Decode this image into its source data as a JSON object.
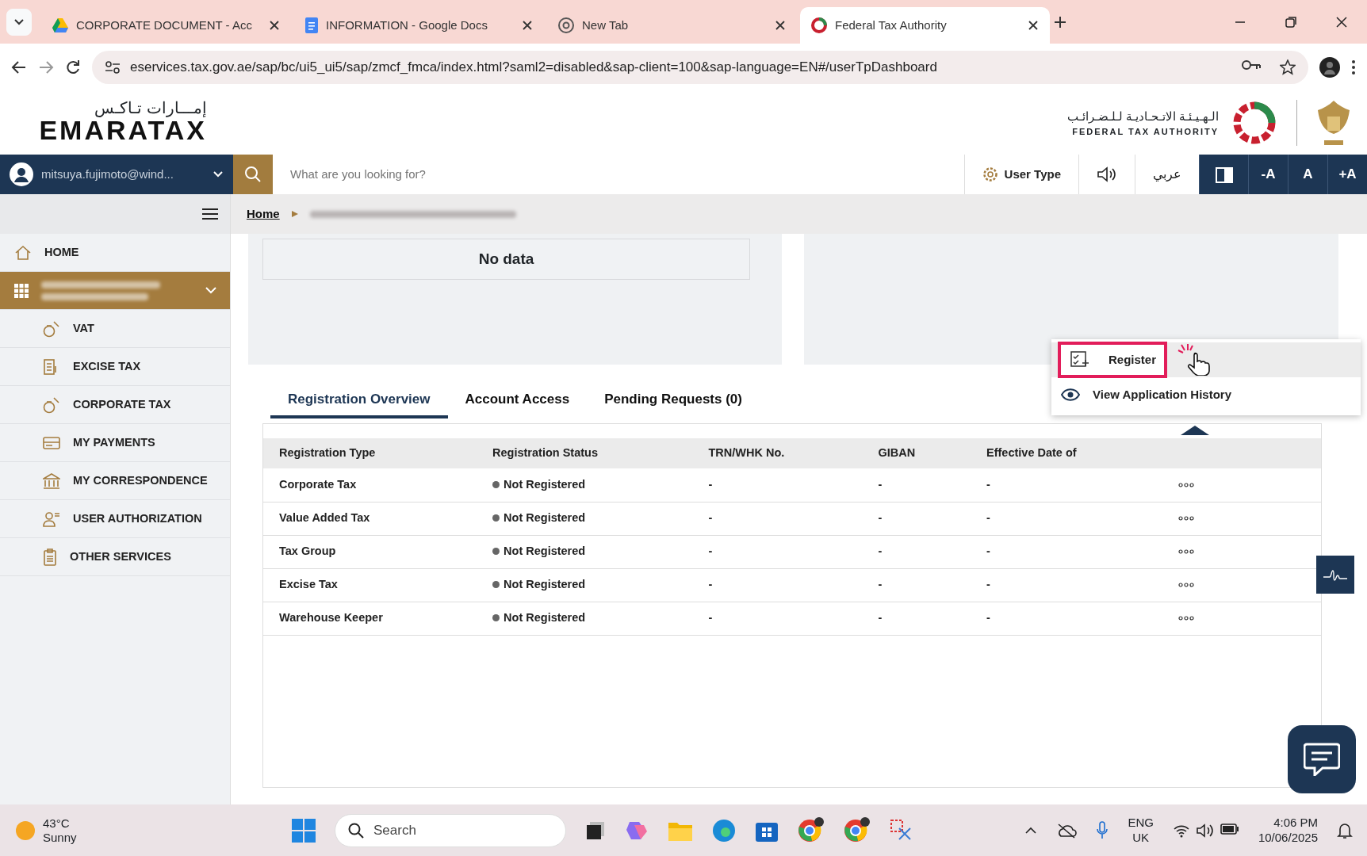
{
  "browser": {
    "tabs": [
      {
        "title": "CORPORATE DOCUMENT - Acc",
        "kind": "drive",
        "selected": false
      },
      {
        "title": "INFORMATION - Google Docs",
        "kind": "docs",
        "selected": false
      },
      {
        "title": "New Tab",
        "kind": "chrome",
        "selected": false
      },
      {
        "title": "Federal Tax Authority",
        "kind": "fta",
        "selected": true
      }
    ],
    "url": "eservices.tax.gov.ae/sap/bc/ui5_ui5/sap/zmcf_fmca/index.html?saml2=disabled&sap-client=100&sap-language=EN#/userTpDashboard"
  },
  "header": {
    "logo_arabic": "إمـــارات تـاكـس",
    "logo": "EMARATAX",
    "authority_arabic": "الـهـيـئـة الاتـحـاديـة لـلـضـرائـب",
    "authority": "FEDERAL TAX AUTHORITY"
  },
  "toolbar": {
    "user": "mitsuya.fujimoto@wind...",
    "search_placeholder": "What are you looking for?",
    "user_type": "User Type",
    "language": "عربي",
    "font_buttons": [
      "-A",
      "A",
      "+A"
    ]
  },
  "breadcrumb": {
    "home": "Home"
  },
  "sidebar": {
    "items": [
      {
        "label": "HOME",
        "kind": "home",
        "selected": false
      },
      {
        "kind": "grid",
        "selected": true,
        "expanded": true,
        "children": [
          {
            "label": "VAT",
            "kind": "moneybag"
          },
          {
            "label": "EXCISE TAX",
            "kind": "doc"
          },
          {
            "label": "CORPORATE TAX",
            "kind": "moneybag"
          },
          {
            "label": "MY PAYMENTS",
            "kind": "card"
          },
          {
            "label": "MY CORRESPONDENCE",
            "kind": "bank"
          },
          {
            "label": "USER AUTHORIZATION",
            "kind": "user"
          },
          {
            "label": "OTHER SERVICES",
            "kind": "clipboard"
          }
        ]
      }
    ]
  },
  "panel": {
    "message": "No data"
  },
  "tabs": [
    {
      "label": "Registration Overview",
      "selected": true
    },
    {
      "label": "Account Access",
      "selected": false
    },
    {
      "label": "Pending Requests (0)",
      "selected": false
    }
  ],
  "table": {
    "columns": [
      "Registration Type",
      "Registration Status",
      "TRN/WHK No.",
      "GIBAN",
      "Effective Date of"
    ],
    "rows": [
      {
        "type": "Corporate Tax",
        "status": "Not Registered",
        "trn": "-",
        "giban": "-",
        "date": "-"
      },
      {
        "type": "Value Added Tax",
        "status": "Not Registered",
        "trn": "-",
        "giban": "-",
        "date": "-"
      },
      {
        "type": "Tax Group",
        "status": "Not Registered",
        "trn": "-",
        "giban": "-",
        "date": "-"
      },
      {
        "type": "Excise Tax",
        "status": "Not Registered",
        "trn": "-",
        "giban": "-",
        "date": "-"
      },
      {
        "type": "Warehouse Keeper",
        "status": "Not Registered",
        "trn": "-",
        "giban": "-",
        "date": "-"
      }
    ]
  },
  "menu": {
    "items": [
      {
        "label": "Register",
        "kind": "register",
        "selected": true
      },
      {
        "label": "View Application History",
        "kind": "eye",
        "selected": false
      }
    ]
  },
  "taskbar": {
    "temperature": "43°C",
    "weather": "Sunny",
    "search": "Search",
    "lang": "ENG",
    "region": "UK",
    "time": "4:06 PM",
    "date": "10/06/2025"
  }
}
